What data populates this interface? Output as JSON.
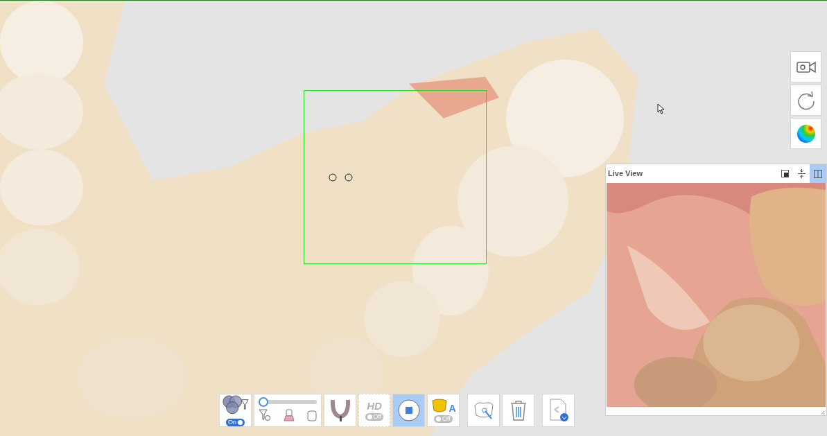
{
  "toolbar": {
    "items": [
      {
        "kind": "filter",
        "toggle": {
          "label": "On",
          "on": true
        },
        "selected": false
      },
      {
        "kind": "slider",
        "level": 0,
        "selected": false
      },
      {
        "kind": "arch",
        "selected": false
      },
      {
        "kind": "hd",
        "label": "HD",
        "toggle": {
          "label": "Off",
          "on": false
        },
        "selected": false
      },
      {
        "kind": "stop",
        "selected": true
      },
      {
        "kind": "ai",
        "label": "A",
        "toggle": {
          "label": "Off",
          "on": false
        },
        "selected": false
      },
      {
        "kind": "trim",
        "selected": false
      },
      {
        "kind": "delete",
        "selected": false
      },
      {
        "kind": "export",
        "selected": false
      }
    ]
  },
  "side_buttons": [
    {
      "kind": "camera"
    },
    {
      "kind": "reset"
    },
    {
      "kind": "color"
    }
  ],
  "live_view": {
    "title": "Live View",
    "buttons": [
      {
        "kind": "float",
        "selected": false
      },
      {
        "kind": "fit",
        "selected": false
      },
      {
        "kind": "split",
        "selected": true
      }
    ]
  }
}
